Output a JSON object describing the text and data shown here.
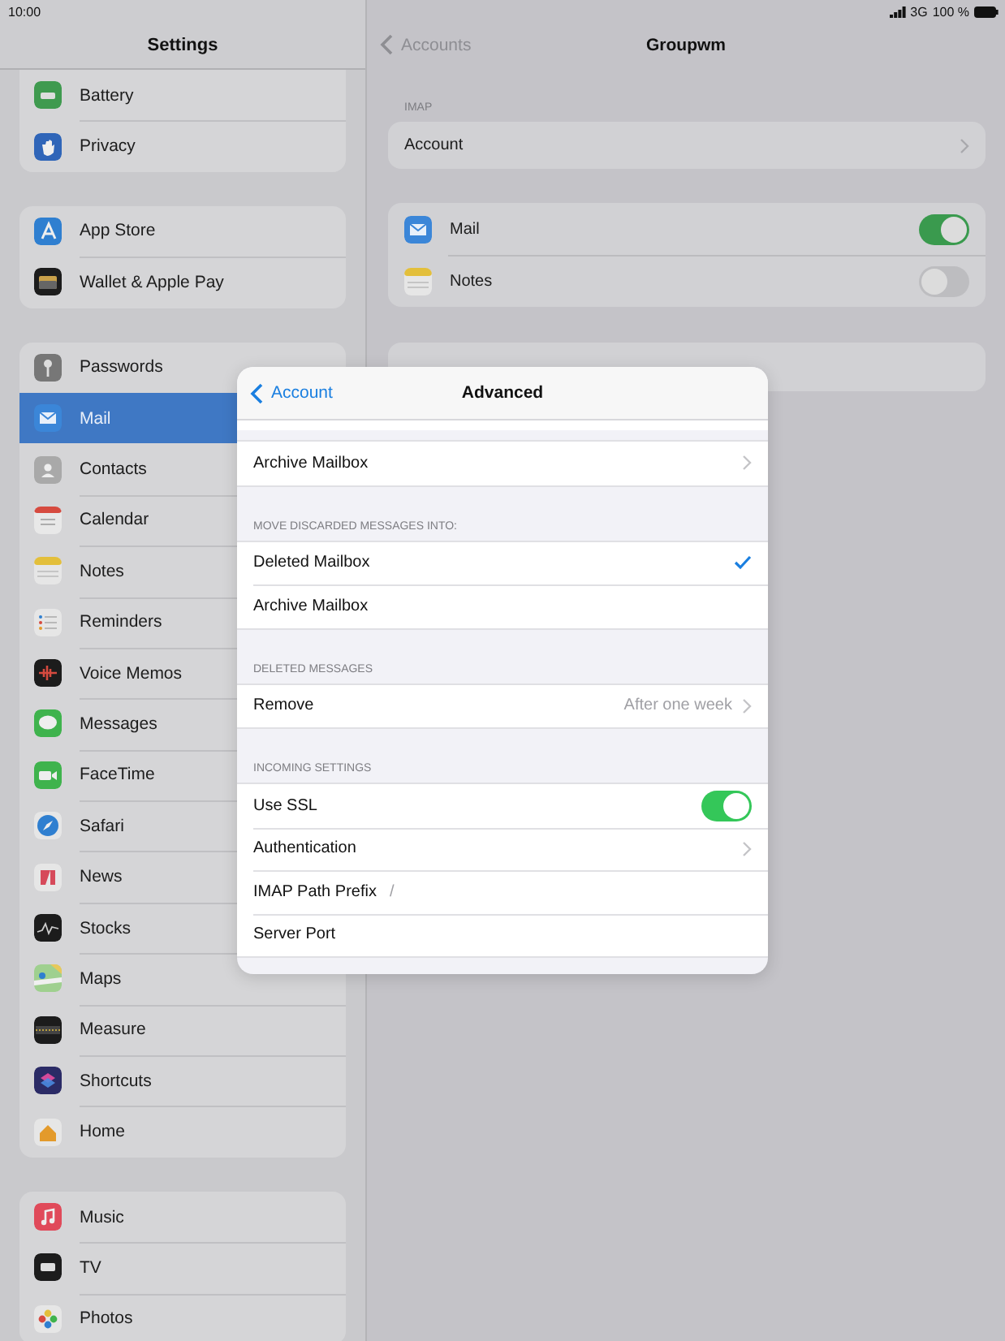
{
  "status_bar": {
    "time": "10:00",
    "network": "3G",
    "battery": "100 %"
  },
  "sidebar": {
    "title": "Settings",
    "groups": [
      {
        "items": [
          {
            "label": "Battery",
            "selected": false
          },
          {
            "label": "Privacy",
            "selected": false
          }
        ]
      },
      {
        "items": [
          {
            "label": "App Store",
            "selected": false
          },
          {
            "label": "Wallet & Apple Pay",
            "selected": false
          }
        ]
      },
      {
        "items": [
          {
            "label": "Passwords",
            "selected": false
          },
          {
            "label": "Mail",
            "selected": true
          },
          {
            "label": "Contacts",
            "selected": false
          },
          {
            "label": "Calendar",
            "selected": false
          },
          {
            "label": "Notes",
            "selected": false
          },
          {
            "label": "Reminders",
            "selected": false
          },
          {
            "label": "Voice Memos",
            "selected": false
          },
          {
            "label": "Messages",
            "selected": false
          },
          {
            "label": "FaceTime",
            "selected": false
          },
          {
            "label": "Safari",
            "selected": false
          },
          {
            "label": "News",
            "selected": false
          },
          {
            "label": "Stocks",
            "selected": false
          },
          {
            "label": "Maps",
            "selected": false
          },
          {
            "label": "Measure",
            "selected": false
          },
          {
            "label": "Shortcuts",
            "selected": false
          },
          {
            "label": "Home",
            "selected": false
          }
        ]
      },
      {
        "items": [
          {
            "label": "Music",
            "selected": false
          },
          {
            "label": "TV",
            "selected": false
          },
          {
            "label": "Photos",
            "selected": false
          }
        ]
      }
    ]
  },
  "detail": {
    "back": "Accounts",
    "title": "Groupwm",
    "sections": [
      {
        "header": "IMAP",
        "rows": [
          {
            "label": "Account",
            "kind": "link"
          }
        ]
      },
      {
        "rows": [
          {
            "label": "Mail",
            "kind": "toggle",
            "on": true
          },
          {
            "label": "Notes",
            "kind": "toggle",
            "on": false
          }
        ]
      }
    ]
  },
  "modal": {
    "back": "Account",
    "title": "Advanced",
    "sections": [
      {
        "rows": [
          {
            "label": "Archive Mailbox",
            "kind": "link"
          }
        ]
      },
      {
        "header": "MOVE DISCARDED MESSAGES INTO:",
        "rows": [
          {
            "label": "Deleted Mailbox",
            "kind": "option",
            "selected": true
          },
          {
            "label": "Archive Mailbox",
            "kind": "option",
            "selected": false
          }
        ]
      },
      {
        "header": "DELETED MESSAGES",
        "rows": [
          {
            "label": "Remove",
            "kind": "link",
            "value": "After one week"
          }
        ]
      },
      {
        "header": "INCOMING SETTINGS",
        "rows": [
          {
            "label": "Use SSL",
            "kind": "toggle",
            "on": true
          },
          {
            "label": "Authentication",
            "kind": "link"
          },
          {
            "label": "IMAP Path Prefix",
            "kind": "field",
            "value": "/"
          },
          {
            "label": "Server Port",
            "kind": "field"
          }
        ]
      }
    ]
  }
}
